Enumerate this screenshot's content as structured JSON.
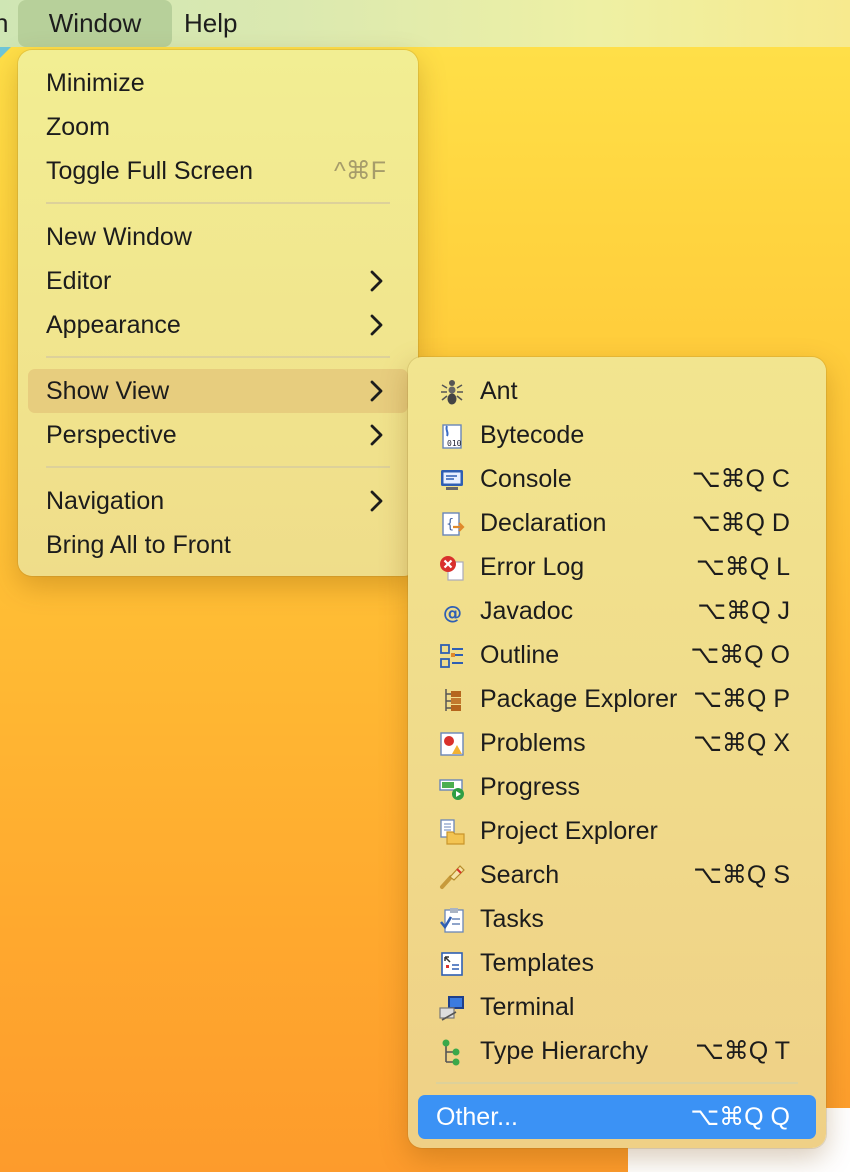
{
  "menubar": {
    "items": [
      {
        "label": "n"
      },
      {
        "label": "Window"
      },
      {
        "label": "Help"
      }
    ]
  },
  "window_menu": {
    "items": [
      {
        "label": "Minimize"
      },
      {
        "label": "Zoom"
      },
      {
        "label": "Toggle Full Screen",
        "shortcut": "^⌘F"
      },
      {
        "label": "New Window"
      },
      {
        "label": "Editor"
      },
      {
        "label": "Appearance"
      },
      {
        "label": "Show View"
      },
      {
        "label": "Perspective"
      },
      {
        "label": "Navigation"
      },
      {
        "label": "Bring All to Front"
      }
    ]
  },
  "show_view_menu": {
    "items": [
      {
        "label": "Ant",
        "icon": "ant-icon"
      },
      {
        "label": "Bytecode",
        "icon": "bytecode-icon"
      },
      {
        "label": "Console",
        "shortcut": "⌥⌘Q C",
        "icon": "console-icon"
      },
      {
        "label": "Declaration",
        "shortcut": "⌥⌘Q D",
        "icon": "declaration-icon"
      },
      {
        "label": "Error Log",
        "shortcut": "⌥⌘Q L",
        "icon": "error-log-icon"
      },
      {
        "label": "Javadoc",
        "shortcut": "⌥⌘Q J",
        "icon": "javadoc-icon"
      },
      {
        "label": "Outline",
        "shortcut": "⌥⌘Q O",
        "icon": "outline-icon"
      },
      {
        "label": "Package Explorer",
        "shortcut": "⌥⌘Q P",
        "icon": "package-explorer-icon"
      },
      {
        "label": "Problems",
        "shortcut": "⌥⌘Q X",
        "icon": "problems-icon"
      },
      {
        "label": "Progress",
        "icon": "progress-icon"
      },
      {
        "label": "Project Explorer",
        "icon": "project-explorer-icon"
      },
      {
        "label": "Search",
        "shortcut": "⌥⌘Q S",
        "icon": "search-icon"
      },
      {
        "label": "Tasks",
        "icon": "tasks-icon"
      },
      {
        "label": "Templates",
        "icon": "templates-icon"
      },
      {
        "label": "Terminal",
        "icon": "terminal-icon"
      },
      {
        "label": "Type Hierarchy",
        "shortcut": "⌥⌘Q T",
        "icon": "type-hierarchy-icon"
      },
      {
        "label": "Other...",
        "shortcut": "⌥⌘Q Q"
      }
    ]
  },
  "colors": {
    "selection": "#3b92f5",
    "hover": "#e7cd7e"
  }
}
